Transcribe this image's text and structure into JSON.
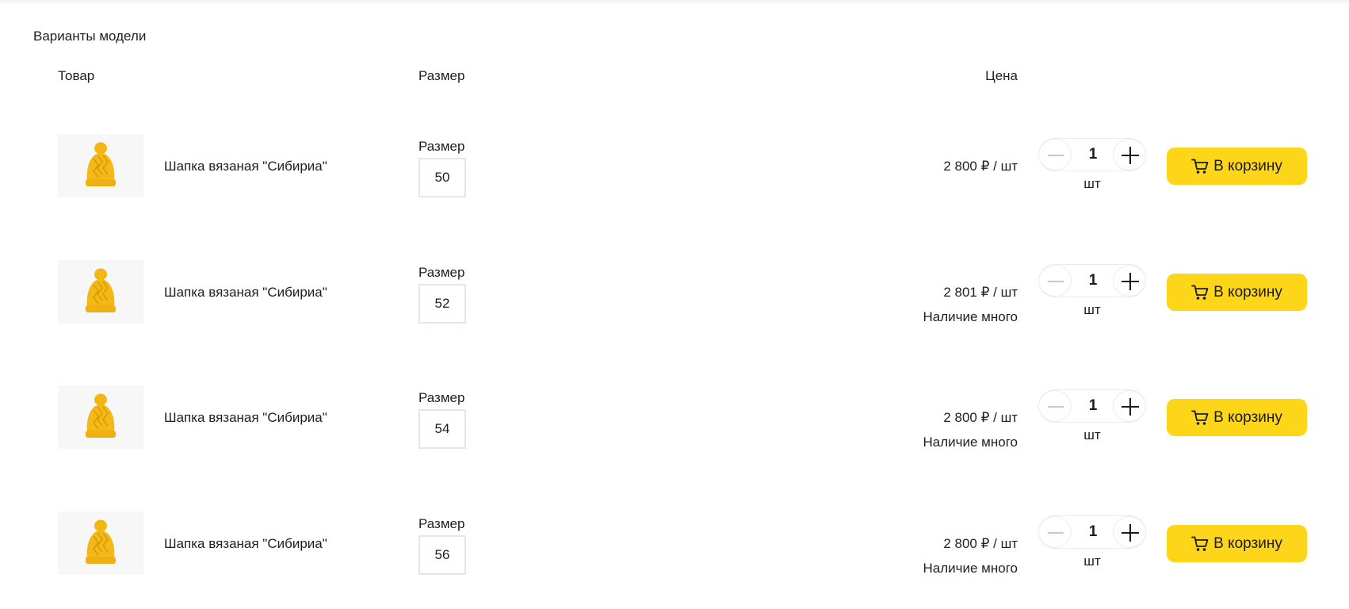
{
  "section_title": "Варианты модели",
  "columns": {
    "product": "Товар",
    "size": "Размер",
    "price": "Цена"
  },
  "colors": {
    "button_bg": "#fdd519",
    "hat": "#f4b916",
    "size_border": "#dfe9ea"
  },
  "variants": [
    {
      "name": "Шапка вязаная \"Сибириа\"",
      "size_label": "Размер",
      "size": "50",
      "price": "2 800 ₽ / шт",
      "stock": "",
      "qty": "1",
      "unit": "шт",
      "button": "В корзину",
      "image": "yellow-knit-hat"
    },
    {
      "name": "Шапка вязаная \"Сибириа\"",
      "size_label": "Размер",
      "size": "52",
      "price": "2 801 ₽ / шт",
      "stock": "Наличие много",
      "qty": "1",
      "unit": "шт",
      "button": "В корзину",
      "image": "yellow-knit-hat"
    },
    {
      "name": "Шапка вязаная \"Сибириа\"",
      "size_label": "Размер",
      "size": "54",
      "price": "2 800 ₽ / шт",
      "stock": "Наличие много",
      "qty": "1",
      "unit": "шт",
      "button": "В корзину",
      "image": "yellow-knit-hat"
    },
    {
      "name": "Шапка вязаная \"Сибириа\"",
      "size_label": "Размер",
      "size": "56",
      "price": "2 800 ₽ / шт",
      "stock": "Наличие много",
      "qty": "1",
      "unit": "шт",
      "button": "В корзину",
      "image": "yellow-knit-hat"
    }
  ]
}
